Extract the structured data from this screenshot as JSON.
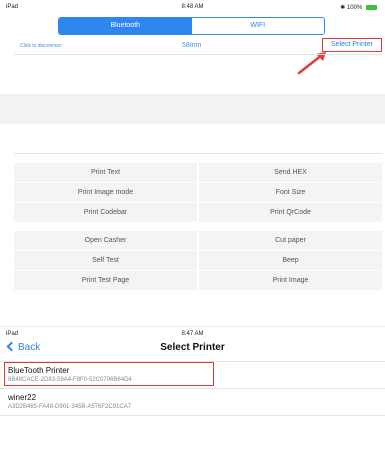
{
  "top_screen": {
    "status": {
      "left": "iPad",
      "time": "8:48 AM",
      "right": "100%"
    },
    "segments": [
      "Bluetooth",
      "WIFI"
    ],
    "disconnect_label": "Click to disconnect",
    "paper_size": "58mm",
    "select_printer_label": "Select Printer",
    "buttons": [
      [
        "Print Text",
        "Send HEX"
      ],
      [
        "Print Image mode",
        "Font Size"
      ],
      [
        "Print Codebar",
        "Print QrCode"
      ],
      [
        "Open Casher",
        "Cut paper"
      ],
      [
        "Self Test",
        "Beep"
      ],
      [
        "Print Test Page",
        "Print Image"
      ]
    ],
    "colors": {
      "accent": "#2e86f0",
      "highlight": "#e53935"
    }
  },
  "bottom_screen": {
    "status": {
      "left": "iPad",
      "time": "8:47 AM"
    },
    "back_label": "Back",
    "title": "Select Printer",
    "devices": [
      {
        "name": "BlueTooth Printer",
        "uuid": "8B48CACE-2D83-59A4-F8F0-52C0706B64D4"
      },
      {
        "name": "winer22",
        "uuid": "A3D2B485-FA48-D901-345B-A576F2C91CA7"
      }
    ]
  }
}
